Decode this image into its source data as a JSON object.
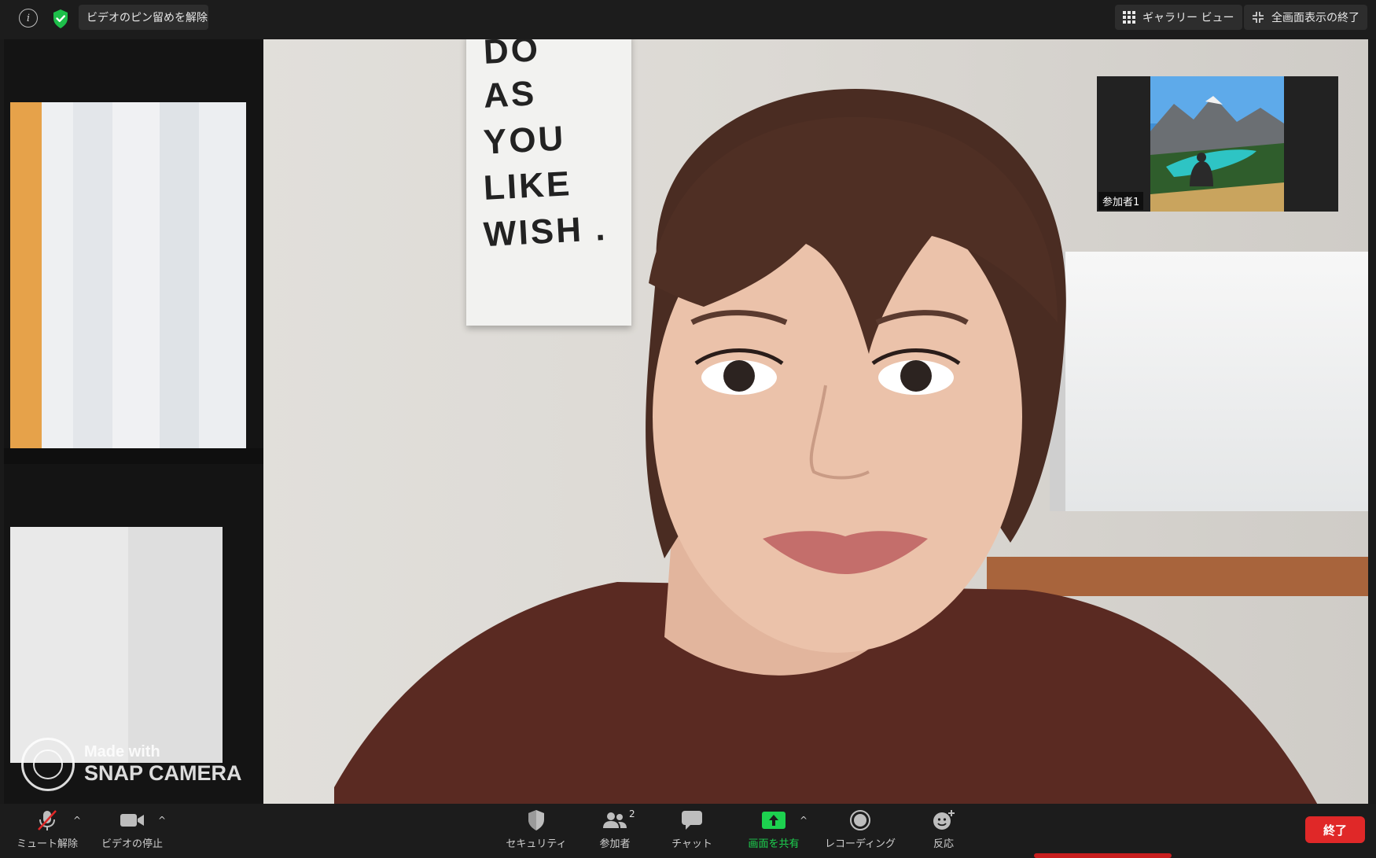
{
  "topbar": {
    "info_icon": "info-icon",
    "security_icon": "shield-check-icon",
    "unpin_video_label": "ビデオのピン留めを解除",
    "gallery_view_label": "ギャラリー ビュー",
    "exit_fullscreen_label": "全画面表示の終了",
    "gallery_icon": "grid-icon",
    "exit_fullscreen_icon": "collapse-icon"
  },
  "main_video": {
    "poster_lines": [
      "DO",
      "AS",
      "YOU",
      "LIKE",
      "WISH ."
    ],
    "watermark": {
      "line1": "Made with",
      "line2": "SNAP CAMERA"
    }
  },
  "thumbnail": {
    "participant_label": "参加者1"
  },
  "toolbar": {
    "mute": {
      "label": "ミュート解除",
      "icon": "mic-off-icon"
    },
    "video": {
      "label": "ビデオの停止",
      "icon": "camera-icon"
    },
    "security": {
      "label": "セキュリティ",
      "icon": "shield-icon"
    },
    "participants": {
      "label": "参加者",
      "count": "2",
      "icon": "participants-icon"
    },
    "chat": {
      "label": "チャット",
      "icon": "chat-icon"
    },
    "share": {
      "label": "画面を共有",
      "icon": "share-screen-icon"
    },
    "record": {
      "label": "レコーディング",
      "icon": "record-icon"
    },
    "reactions": {
      "label": "反応",
      "icon": "emoji-icon"
    },
    "end": {
      "label": "終了"
    }
  },
  "colors": {
    "end_red": "#e02828",
    "share_green": "#1dd14f",
    "bar_bg": "#1c1c1c"
  }
}
